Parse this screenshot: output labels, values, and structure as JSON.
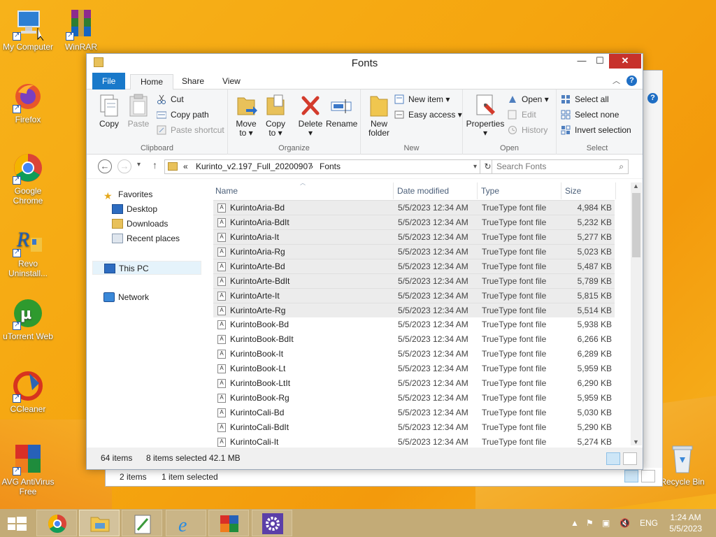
{
  "desktop": {
    "icons": [
      {
        "label": "My Computer"
      },
      {
        "label": "WinRAR"
      },
      {
        "label": "Firefox"
      },
      {
        "label": "Google Chrome"
      },
      {
        "label": "Revo Uninstall..."
      },
      {
        "label": "uTorrent Web"
      },
      {
        "label": "CCleaner"
      },
      {
        "label": "AVG AntiVirus Free"
      },
      {
        "label": "Recycle Bin"
      }
    ]
  },
  "back_window": {
    "status_items": "2 items",
    "status_selected": "1 item selected"
  },
  "window": {
    "title": "Fonts",
    "tabs": {
      "file": "File",
      "home": "Home",
      "share": "Share",
      "view": "View"
    },
    "ribbon": {
      "clipboard": {
        "label": "Clipboard",
        "copy": "Copy",
        "paste": "Paste",
        "cut": "Cut",
        "copy_path": "Copy path",
        "paste_shortcut": "Paste shortcut"
      },
      "organize": {
        "label": "Organize",
        "move_to": "Move to ▾",
        "copy_to": "Copy to ▾",
        "delete": "Delete",
        "rename": "Rename",
        "move_top": "Move",
        "move_bottom": "to ▾",
        "copy_top": "Copy",
        "copy_bottom": "to ▾",
        "delete_caret": "▾"
      },
      "new": {
        "label": "New",
        "new_folder_top": "New",
        "new_folder_bottom": "folder",
        "new_item": "New item ▾",
        "easy_access": "Easy access ▾"
      },
      "open": {
        "label": "Open",
        "properties": "Properties",
        "properties_caret": "▾",
        "open": "Open ▾",
        "edit": "Edit",
        "history": "History"
      },
      "select": {
        "label": "Select",
        "select_all": "Select all",
        "select_none": "Select none",
        "invert": "Invert selection"
      }
    },
    "address": {
      "chevron": "«",
      "crumb1": "Kurinto_v2.197_Full_20200907",
      "sep": "›",
      "crumb2": "Fonts",
      "search_placeholder": "Search Fonts"
    },
    "nav": {
      "favorites": "Favorites",
      "desktop": "Desktop",
      "downloads": "Downloads",
      "recent": "Recent places",
      "this_pc": "This PC",
      "network": "Network"
    },
    "columns": {
      "name": "Name",
      "date": "Date modified",
      "type": "Type",
      "size": "Size"
    },
    "files": [
      {
        "name": "KurintoAria-Bd",
        "date": "5/5/2023 12:34 AM",
        "type": "TrueType font file",
        "size": "4,984 KB",
        "selected": true
      },
      {
        "name": "KurintoAria-BdIt",
        "date": "5/5/2023 12:34 AM",
        "type": "TrueType font file",
        "size": "5,232 KB",
        "selected": true
      },
      {
        "name": "KurintoAria-It",
        "date": "5/5/2023 12:34 AM",
        "type": "TrueType font file",
        "size": "5,277 KB",
        "selected": true
      },
      {
        "name": "KurintoAria-Rg",
        "date": "5/5/2023 12:34 AM",
        "type": "TrueType font file",
        "size": "5,023 KB",
        "selected": true
      },
      {
        "name": "KurintoArte-Bd",
        "date": "5/5/2023 12:34 AM",
        "type": "TrueType font file",
        "size": "5,487 KB",
        "selected": true
      },
      {
        "name": "KurintoArte-BdIt",
        "date": "5/5/2023 12:34 AM",
        "type": "TrueType font file",
        "size": "5,789 KB",
        "selected": true
      },
      {
        "name": "KurintoArte-It",
        "date": "5/5/2023 12:34 AM",
        "type": "TrueType font file",
        "size": "5,815 KB",
        "selected": true
      },
      {
        "name": "KurintoArte-Rg",
        "date": "5/5/2023 12:34 AM",
        "type": "TrueType font file",
        "size": "5,514 KB",
        "selected": true
      },
      {
        "name": "KurintoBook-Bd",
        "date": "5/5/2023 12:34 AM",
        "type": "TrueType font file",
        "size": "5,938 KB",
        "selected": false
      },
      {
        "name": "KurintoBook-BdIt",
        "date": "5/5/2023 12:34 AM",
        "type": "TrueType font file",
        "size": "6,266 KB",
        "selected": false
      },
      {
        "name": "KurintoBook-It",
        "date": "5/5/2023 12:34 AM",
        "type": "TrueType font file",
        "size": "6,289 KB",
        "selected": false
      },
      {
        "name": "KurintoBook-Lt",
        "date": "5/5/2023 12:34 AM",
        "type": "TrueType font file",
        "size": "5,959 KB",
        "selected": false
      },
      {
        "name": "KurintoBook-LtIt",
        "date": "5/5/2023 12:34 AM",
        "type": "TrueType font file",
        "size": "6,290 KB",
        "selected": false
      },
      {
        "name": "KurintoBook-Rg",
        "date": "5/5/2023 12:34 AM",
        "type": "TrueType font file",
        "size": "5,959 KB",
        "selected": false
      },
      {
        "name": "KurintoCali-Bd",
        "date": "5/5/2023 12:34 AM",
        "type": "TrueType font file",
        "size": "5,030 KB",
        "selected": false
      },
      {
        "name": "KurintoCali-BdIt",
        "date": "5/5/2023 12:34 AM",
        "type": "TrueType font file",
        "size": "5,290 KB",
        "selected": false
      },
      {
        "name": "KurintoCali-It",
        "date": "5/5/2023 12:34 AM",
        "type": "TrueType font file",
        "size": "5,274 KB",
        "selected": false
      }
    ],
    "status": {
      "items": "64 items",
      "selected": "8 items selected",
      "size": "42.1 MB"
    }
  },
  "taskbar": {
    "lang": "ENG",
    "time": "1:24 AM",
    "date": "5/5/2023"
  },
  "colors": {
    "accent": "#1979ca",
    "close": "#c7312b",
    "selection": "#ececec"
  }
}
